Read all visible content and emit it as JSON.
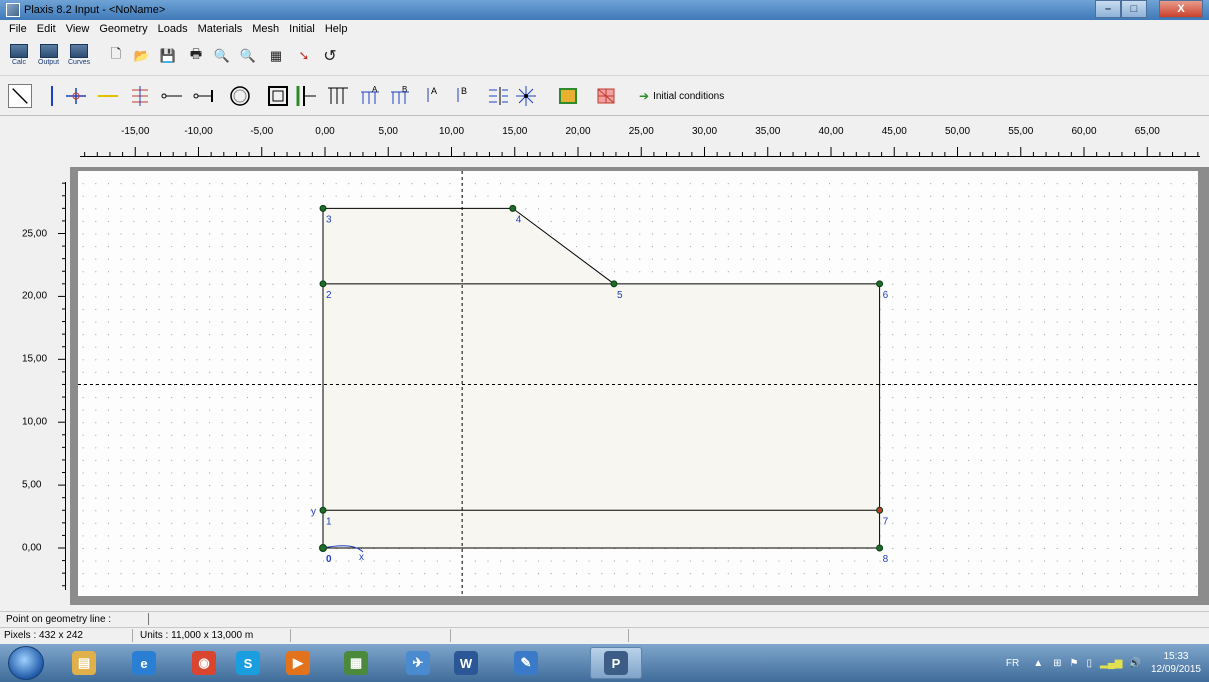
{
  "window": {
    "title": "Plaxis 8.2 Input - <NoName>",
    "minimize_glyph": "–",
    "maximize_glyph": "□",
    "close_glyph": "X"
  },
  "menu": [
    "File",
    "Edit",
    "View",
    "Geometry",
    "Loads",
    "Materials",
    "Mesh",
    "Initial",
    "Help"
  ],
  "toolbar": {
    "calc_label": "Calc",
    "output_label": "Output",
    "curves_label": "Curves",
    "initial_conditions_label": "Initial conditions"
  },
  "ruler_x": {
    "labels": [
      "-15,00",
      "-10,00",
      "-5,00",
      "0,00",
      "5,00",
      "10,00",
      "15,00",
      "20,00",
      "25,00",
      "30,00",
      "35,00",
      "40,00",
      "45,00",
      "50,00",
      "55,00",
      "60,00",
      "65,00"
    ],
    "values": [
      -15,
      -10,
      -5,
      0,
      5,
      10,
      15,
      20,
      25,
      30,
      35,
      40,
      45,
      50,
      55,
      60,
      65
    ]
  },
  "ruler_y": {
    "labels": [
      "25,00",
      "20,00",
      "15,00",
      "10,00",
      "5,00",
      "0,00"
    ],
    "values": [
      25,
      20,
      15,
      10,
      5,
      0
    ]
  },
  "geometry": {
    "points": [
      {
        "id": "0",
        "x": 0,
        "y": 0,
        "color": "#1f6b2a"
      },
      {
        "id": "1",
        "x": 0,
        "y": 3,
        "color": "#1f6b2a"
      },
      {
        "id": "2",
        "x": 0,
        "y": 21,
        "color": "#1f6b2a"
      },
      {
        "id": "3",
        "x": 0,
        "y": 27,
        "color": "#1f6b2a"
      },
      {
        "id": "4",
        "x": 15,
        "y": 27,
        "color": "#1f6b2a"
      },
      {
        "id": "5",
        "x": 23,
        "y": 21,
        "color": "#1f6b2a"
      },
      {
        "id": "6",
        "x": 44,
        "y": 21,
        "color": "#1f6b2a"
      },
      {
        "id": "7",
        "x": 44,
        "y": 3,
        "color": "#c0392b"
      },
      {
        "id": "8",
        "x": 44,
        "y": 0,
        "color": "#1f6b2a"
      }
    ],
    "lines": [
      [
        "0",
        "1"
      ],
      [
        "1",
        "2"
      ],
      [
        "2",
        "3"
      ],
      [
        "3",
        "4"
      ],
      [
        "4",
        "5"
      ],
      [
        "2",
        "5"
      ],
      [
        "5",
        "6"
      ],
      [
        "6",
        "7"
      ],
      [
        "7",
        "8"
      ],
      [
        "8",
        "0"
      ],
      [
        "1",
        "7"
      ]
    ],
    "cursor": {
      "x": 11,
      "y": 13
    },
    "axis_x_label": "x",
    "axis_y_label": "y"
  },
  "status": {
    "hint": "Point on geometry line :",
    "pixels": "Pixels : 432 x 242",
    "units": "Units  : 11,000 x 13,000 m"
  },
  "taskbar": {
    "apps": [
      {
        "name": "explorer",
        "glyph": "▤",
        "color": "#e0b04a"
      },
      {
        "name": "ie",
        "glyph": "e",
        "color": "#2a7fd4"
      },
      {
        "name": "chrome",
        "glyph": "◉",
        "color": "#d9452f"
      },
      {
        "name": "skype",
        "glyph": "S",
        "color": "#1a9ee0"
      },
      {
        "name": "media",
        "glyph": "▶",
        "color": "#e2731c"
      },
      {
        "name": "app",
        "glyph": "▦",
        "color": "#4a8a3a"
      },
      {
        "name": "mail",
        "glyph": "✈",
        "color": "#4a8ad0"
      },
      {
        "name": "word",
        "glyph": "W",
        "color": "#2b5797"
      },
      {
        "name": "paint",
        "glyph": "✎",
        "color": "#3a7ac8"
      },
      {
        "name": "plaxis",
        "glyph": "P",
        "color": "#3c5d86"
      }
    ],
    "lang": "FR",
    "time": "15:33",
    "date": "12/09/2015"
  }
}
